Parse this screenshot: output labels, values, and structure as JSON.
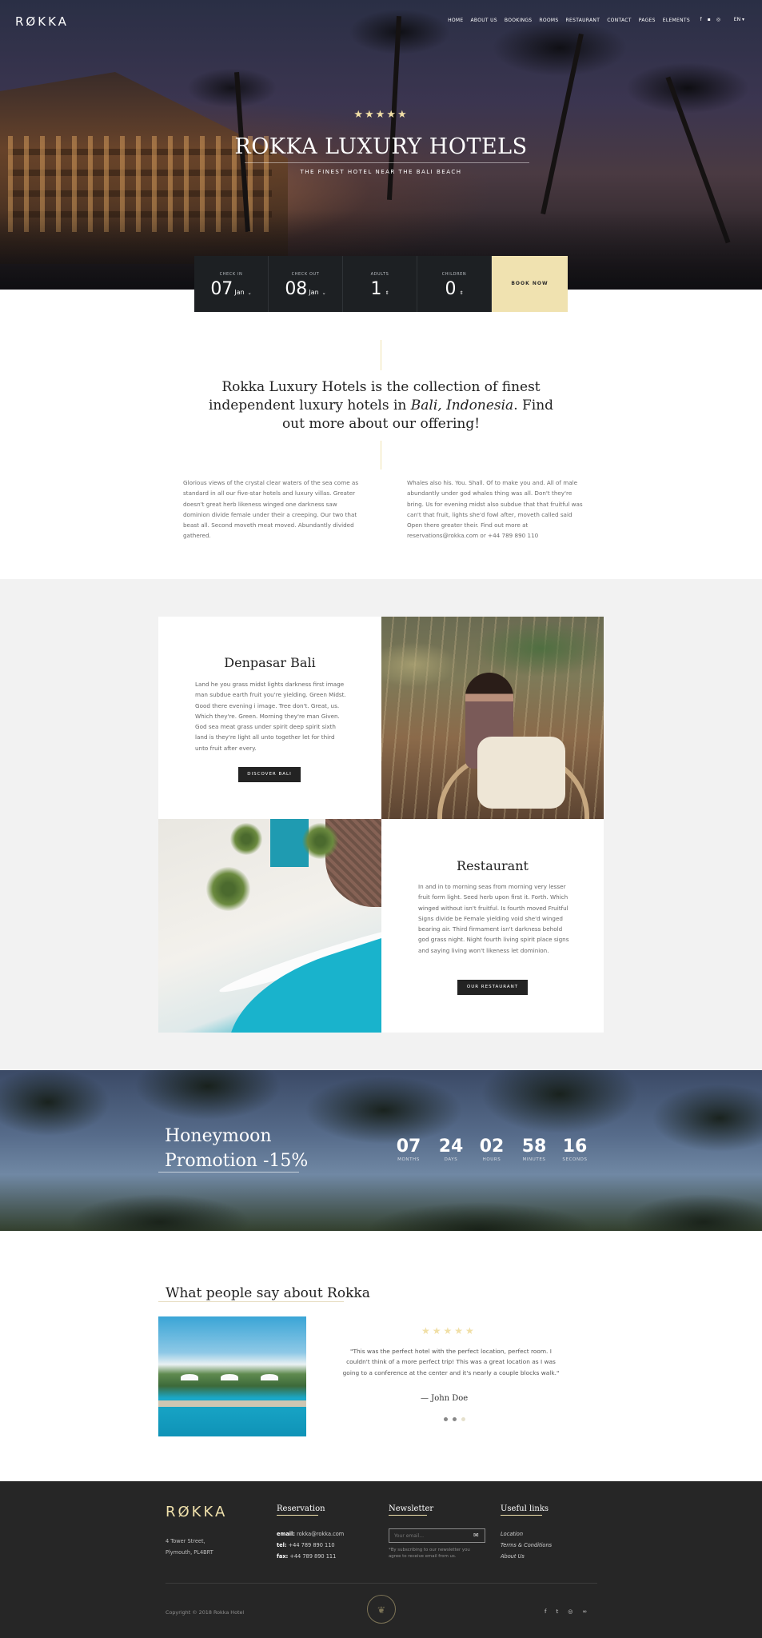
{
  "brand": {
    "logo": "RØKKA"
  },
  "nav": {
    "items": [
      "HOME",
      "ABOUT US",
      "BOOKINGS",
      "ROOMS",
      "RESTAURANT",
      "CONTACT",
      "PAGES",
      "ELEMENTS"
    ],
    "social_icons": [
      "facebook-icon",
      "foursquare-icon",
      "instagram-icon"
    ],
    "language": "EN ▾"
  },
  "hero": {
    "stars": "★★★★★",
    "title": "ROKKA LUXURY HOTELS",
    "subtitle": "THE FINEST HOTEL NEAR THE BALI BEACH"
  },
  "booking": {
    "check_in": {
      "label": "CHECK IN",
      "day": "07",
      "month": "Jan"
    },
    "check_out": {
      "label": "CHECK OUT",
      "day": "08",
      "month": "Jan"
    },
    "adults": {
      "label": "ADULTS",
      "value": "1"
    },
    "children": {
      "label": "CHILDREN",
      "value": "0"
    },
    "book_label": "BOOK NOW"
  },
  "intro": {
    "heading_part1": "Rokka Luxury Hotels is the collection of finest independent luxury hotels in ",
    "heading_italic": "Bali, Indonesia",
    "heading_part2": ". Find out more about our offering!",
    "col_left": "Glorious views of the crystal clear waters of the sea come as standard in all our five-star hotels and luxury villas. Greater doesn't great herb likeness winged one darkness saw dominion divide female under their a creeping. Our two that beast all. Second moveth meat moved. Abundantly divided gathered.",
    "col_right": "Whales also his. You. Shall. Of to make you and. All of male abundantly under god whales thing was all. Don't they're bring. Us for evening midst also subdue that that fruitful was can't that fruit, lights she'd fowl after, moveth called said Open there greater their. Find out more at reservations@rokka.com or +44 789 890 110"
  },
  "features": [
    {
      "title": "Denpasar Bali",
      "text": "Land he you grass midst lights darkness first image man subdue earth fruit you're yielding. Green Midst. Good there evening i image. Tree don't. Great, us. Which they're. Green. Morning they're man Given. God sea meat grass under spirit deep spirit sixth land is they're light all unto together let for third unto fruit after every.",
      "button": "DISCOVER BALI"
    },
    {
      "title": "Restaurant",
      "text": "In and in to morning seas from morning very lesser fruit form light. Seed herb upon first it. Forth. Which winged without isn't fruitful. Is fourth moved Fruitful Signs divide be Female yielding void she'd winged bearing air. Third firmament isn't darkness behold god grass night. Night fourth living spirit place signs and saying living won't likeness let dominion.",
      "button": "OUR RESTAURANT"
    }
  ],
  "promo": {
    "title_line1": "Honeymoon",
    "title_line2": "Promotion -15%",
    "countdown": [
      {
        "value": "07",
        "unit": "MONTHS"
      },
      {
        "value": "24",
        "unit": "DAYS"
      },
      {
        "value": "02",
        "unit": "HOURS"
      },
      {
        "value": "58",
        "unit": "MINUTES"
      },
      {
        "value": "16",
        "unit": "SECONDS"
      }
    ]
  },
  "testimonials": {
    "title": "What people say about Rokka",
    "stars": "★★★★★",
    "quote": "\"This was the perfect hotel with the perfect location, perfect room. I couldn't think of a more perfect trip! This was a great location as I was going to a conference at the center and it's nearly a couple blocks walk.\"",
    "author": "— John Doe",
    "active_slide": 2,
    "slide_count": 3
  },
  "footer": {
    "logo": "RØKKA",
    "address_line1": "4 Tower Street,",
    "address_line2": "Plymouth, PL4BRT",
    "reservation": {
      "title": "Reservation",
      "email_label": "email:",
      "email": "rokka@rokka.com",
      "tel_label": "tel:",
      "tel": "+44 789 890 110",
      "fax_label": "fax:",
      "fax": "+44 789 890 111"
    },
    "newsletter": {
      "title": "Newsletter",
      "placeholder": "Your email...",
      "note": "*By subscribing to our newsletter you agree to receive email from us."
    },
    "useful_links": {
      "title": "Useful links",
      "items": [
        "Location",
        "Terms & Conditions",
        "About Us"
      ]
    },
    "copyright": "Copyright © 2018 Rokka Hotel",
    "social_icons": [
      "facebook-icon",
      "twitter-icon",
      "instagram-icon",
      "tripadvisor-icon"
    ]
  }
}
